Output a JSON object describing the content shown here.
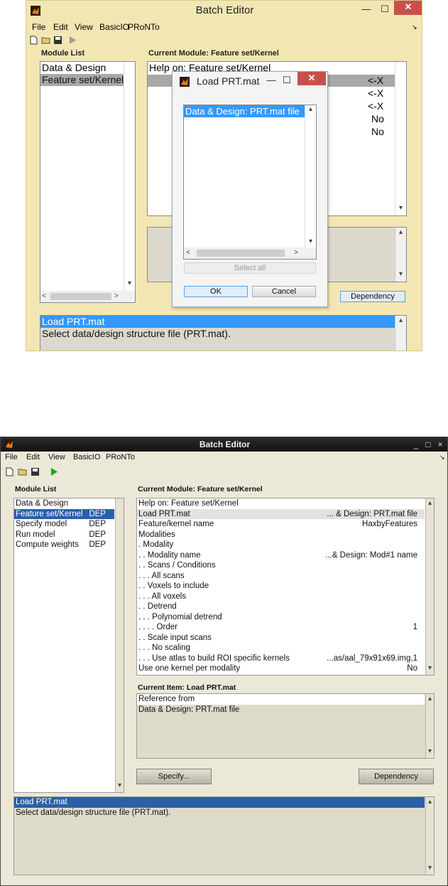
{
  "top": {
    "window_title": "Batch Editor",
    "menu": [
      "File",
      "Edit",
      "View",
      "BasicIO",
      "PRoNTo"
    ],
    "module_list_label": "Module List",
    "module_list": [
      "Data & Design",
      "Feature set/Kernel"
    ],
    "current_module_label": "Current Module: Feature set/Kernel",
    "help_text": "Help on: Feature set/Kernel",
    "values": [
      "<-X",
      "<-X",
      "<-X",
      "No",
      "No"
    ],
    "dependency_button": "Dependency",
    "message_list": [
      "Load PRT.mat",
      "Select data/design structure file (PRT.mat)."
    ],
    "dialog": {
      "title": "Load PRT.mat",
      "item": "Data & Design: PRT.mat file",
      "select_all": "Select all",
      "ok": "OK",
      "cancel": "Cancel"
    },
    "colors": {
      "frame": "#f2e7b3",
      "close": "#c7504a",
      "selection": "#3399ff"
    }
  },
  "bottom": {
    "window_title": "Batch Editor",
    "menu": [
      "File",
      "Edit",
      "View",
      "BasicIO",
      "PRoNTo"
    ],
    "module_list_label": "Module List",
    "module_list": [
      {
        "name": "Data & Design",
        "dep": ""
      },
      {
        "name": "Feature set/Kernel",
        "dep": "DEP"
      },
      {
        "name": "Specify model",
        "dep": "DEP"
      },
      {
        "name": "Run model",
        "dep": "DEP"
      },
      {
        "name": "Compute weights",
        "dep": "DEP"
      }
    ],
    "current_module_label": "Current Module: Feature set/Kernel",
    "module_items": [
      {
        "label": "Help on: Feature set/Kernel",
        "value": ""
      },
      {
        "label": "Load PRT.mat",
        "value": "... & Design: PRT.mat file"
      },
      {
        "label": "Feature/kernel name",
        "value": "HaxbyFeatures"
      },
      {
        "label": "Modalities",
        "value": ""
      },
      {
        "label": ". Modality",
        "value": ""
      },
      {
        "label": ". . Modality name",
        "value": "...& Design: Mod#1 name"
      },
      {
        "label": ". . Scans / Conditions",
        "value": ""
      },
      {
        "label": ". . . All scans",
        "value": ""
      },
      {
        "label": ". . Voxels to include",
        "value": ""
      },
      {
        "label": ". . . All voxels",
        "value": ""
      },
      {
        "label": ". . Detrend",
        "value": ""
      },
      {
        "label": ". . . Polynomial detrend",
        "value": ""
      },
      {
        "label": ". . . . Order",
        "value": "1"
      },
      {
        "label": ". . Scale input scans",
        "value": ""
      },
      {
        "label": ". . . No scaling",
        "value": ""
      },
      {
        "label": ". . . Use atlas to build ROI specific kernels",
        "value": "...as/aal_79x91x69.img,1"
      },
      {
        "label": "Use one kernel per modality",
        "value": "No"
      }
    ],
    "current_item_label": "Current Item: Load PRT.mat",
    "current_item_lines": [
      "Reference from",
      "Data & Design: PRT.mat file"
    ],
    "specify_button": "Specify...",
    "dependency_button": "Dependency",
    "message_list": [
      "Load PRT.mat",
      "Select data/design structure file (PRT.mat)."
    ],
    "window_controls": [
      "_",
      "□",
      "×"
    ],
    "colors": {
      "titlebar": "#1a1a1a",
      "selection": "#2b5fa8",
      "background": "#ebe8d8"
    }
  }
}
